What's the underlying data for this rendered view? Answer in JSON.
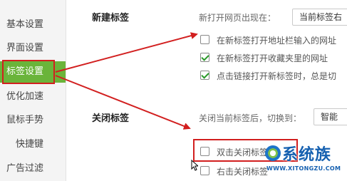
{
  "sidebar": {
    "items": [
      {
        "label": "基本设置"
      },
      {
        "label": "界面设置"
      },
      {
        "label": "标签设置"
      },
      {
        "label": "优化加速"
      },
      {
        "label": "鼠标手势"
      },
      {
        "label": "快捷键"
      },
      {
        "label": "广告过滤"
      }
    ],
    "active_index": 2
  },
  "new_tab": {
    "title": "新建标签",
    "open_label": "新打开网页出现在：",
    "open_select_value": "当前标签右",
    "options": [
      {
        "label": "在新标签打开地址栏输入的网址",
        "checked": false
      },
      {
        "label": "在新标签打开收藏夹里的网址",
        "checked": true
      },
      {
        "label": "点击链接打开新标签时，总是切",
        "checked": true
      }
    ]
  },
  "close_tab": {
    "title": "关闭标签",
    "switch_label": "关闭当前标签后，切换到：",
    "switch_select_value": "智能",
    "options": [
      {
        "label": "双击关闭标签",
        "checked": false
      },
      {
        "label": "右击关闭标签",
        "checked": false
      }
    ]
  },
  "watermark": {
    "text": "系统族",
    "url": "WWW.XITONGZU.COM"
  },
  "colors": {
    "active": "#6ab43a",
    "highlight": "#d21f1f",
    "check": "#2a9a2a"
  }
}
